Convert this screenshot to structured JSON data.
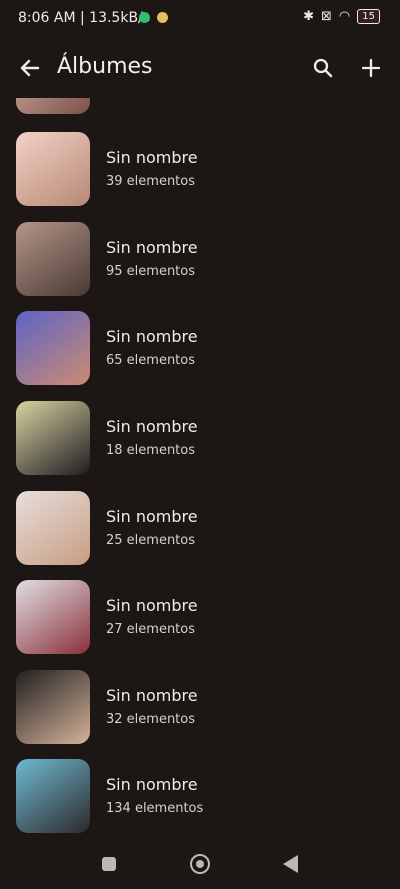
{
  "status_bar": {
    "time_speed": "8:06 AM | 13.5kB/s",
    "battery": "15",
    "icons": [
      "bluetooth-icon",
      "sim-off-icon",
      "wifi-icon",
      "battery-icon"
    ]
  },
  "app_bar": {
    "title": "Álbumes",
    "icons": [
      "back-arrow-icon",
      "search-icon",
      "add-icon"
    ]
  },
  "albums": [
    {
      "name": "Sin nombre",
      "count": "39 elementos",
      "thumb_colors": [
        "#f2d2c6",
        "#b78875"
      ]
    },
    {
      "name": "Sin nombre",
      "count": "95 elementos",
      "thumb_colors": [
        "#b49589",
        "#4a3a34"
      ]
    },
    {
      "name": "Sin nombre",
      "count": "65 elementos",
      "thumb_colors": [
        "#5c63c7",
        "#cd8b72"
      ]
    },
    {
      "name": "Sin nombre",
      "count": "18 elementos",
      "thumb_colors": [
        "#d8d3a0",
        "#1f1c22"
      ]
    },
    {
      "name": "Sin nombre",
      "count": "25 elementos",
      "thumb_colors": [
        "#e6dedb",
        "#c89d82"
      ]
    },
    {
      "name": "Sin nombre",
      "count": "27 elementos",
      "thumb_colors": [
        "#e0e0e4",
        "#8a2f3a"
      ]
    },
    {
      "name": "Sin nombre",
      "count": "32 elementos",
      "thumb_colors": [
        "#202020",
        "#d6b29a"
      ]
    },
    {
      "name": "Sin nombre",
      "count": "134 elementos",
      "thumb_colors": [
        "#6fb9d3",
        "#2d2a2a"
      ]
    }
  ],
  "nav_bar": {
    "icons": [
      "recents-square-icon",
      "home-circle-icon",
      "back-triangle-icon"
    ]
  }
}
